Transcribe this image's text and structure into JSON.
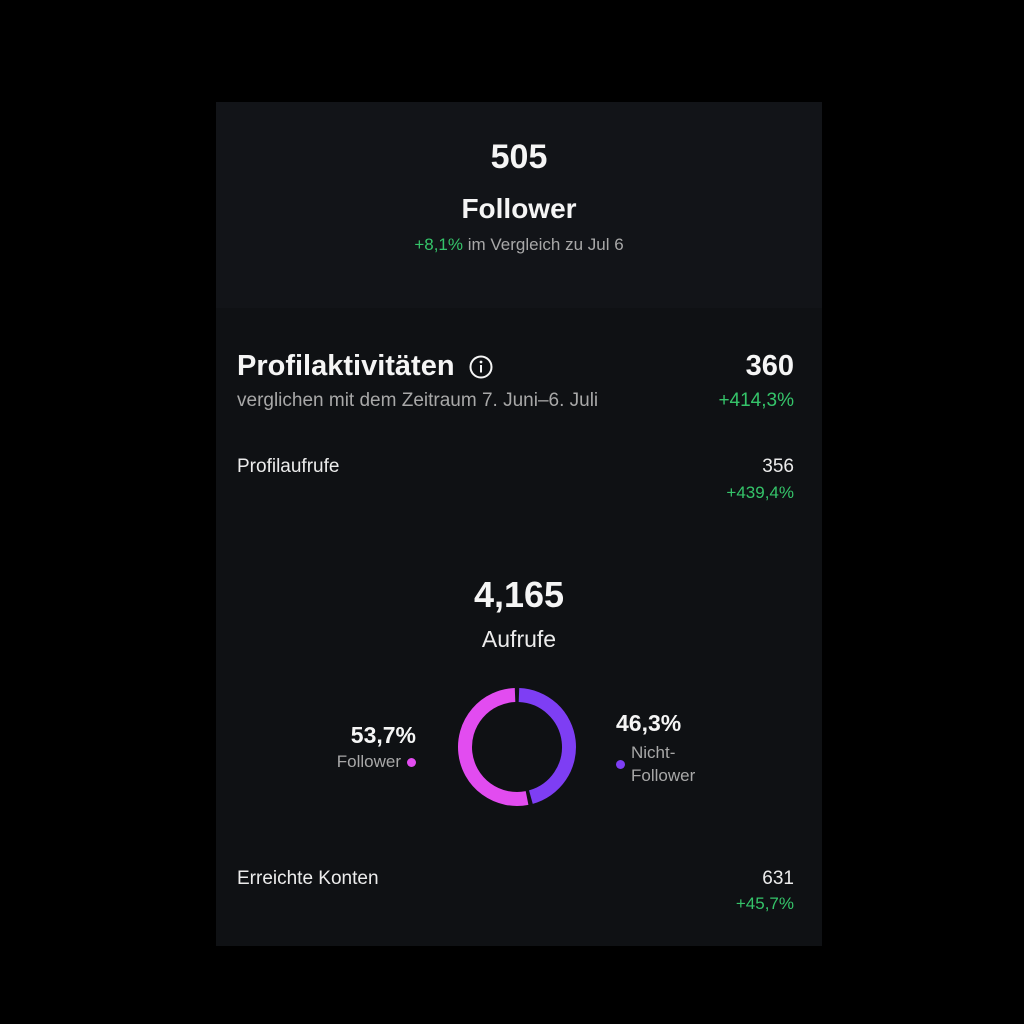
{
  "followers": {
    "count": "505",
    "label": "Follower",
    "change": "+8,1%",
    "compare_text": "im Vergleich zu Jul 6"
  },
  "profile_activity": {
    "title": "Profilaktivitäten",
    "info_icon": "info-icon",
    "value": "360",
    "subtitle": "verglichen mit dem Zeitraum 7. Juni–6. Juli",
    "change": "+414,3%",
    "rows": [
      {
        "label": "Profilaufrufe",
        "value": "356",
        "change": "+439,4%"
      }
    ]
  },
  "views": {
    "count": "4,165",
    "label": "Aufrufe",
    "rows": [
      {
        "label": "Erreichte Konten",
        "value": "631",
        "change": "+45,7%"
      }
    ]
  },
  "chart_data": {
    "type": "pie",
    "style": "donut",
    "slices": [
      {
        "name": "Follower",
        "value": 53.7,
        "label": "53,7%",
        "color": "#e24cf0"
      },
      {
        "name": "Nicht-Follower",
        "value": 46.3,
        "label": "46,3%",
        "color": "#7e3ef4"
      }
    ]
  },
  "colors": {
    "positive": "#35c46a",
    "background": "#000000",
    "card": "#0f1114"
  }
}
